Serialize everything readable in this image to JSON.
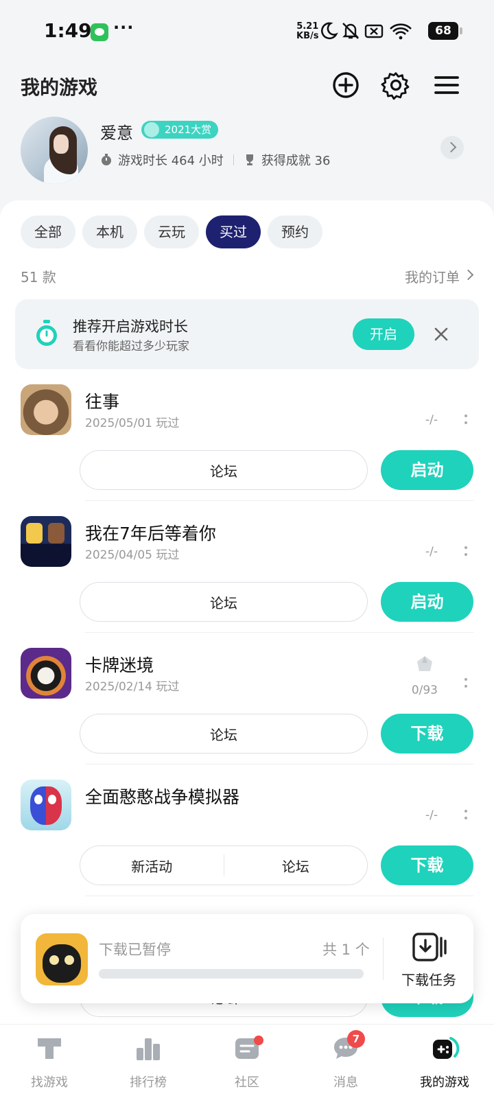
{
  "status_bar": {
    "time": "1:49",
    "more": "···",
    "speed_value": "5.21",
    "speed_unit": "KB/s",
    "battery": "68"
  },
  "header": {
    "title": "我的游戏"
  },
  "profile": {
    "username": "爱意",
    "badge": "2021大赏",
    "playtime": "游戏时长 464 小时",
    "achievements": "获得成就 36"
  },
  "filters": [
    {
      "label": "全部",
      "active": false
    },
    {
      "label": "本机",
      "active": false
    },
    {
      "label": "云玩",
      "active": false
    },
    {
      "label": "买过",
      "active": true
    },
    {
      "label": "预约",
      "active": false
    }
  ],
  "list_meta": {
    "count": "51 款",
    "orders": "我的订单"
  },
  "tip": {
    "title": "推荐开启游戏时长",
    "subtitle": "看看你能超过多少玩家",
    "button": "开启"
  },
  "games": [
    {
      "name": "往事",
      "date": "2025/05/01 玩过",
      "achievement": "-/-",
      "forum": "论坛",
      "action": "启动"
    },
    {
      "name": "我在7年后等着你",
      "date": "2025/04/05 玩过",
      "achievement": "-/-",
      "forum": "论坛",
      "action": "启动"
    },
    {
      "name": "卡牌迷境",
      "date": "2025/02/14 玩过",
      "achievement": "0/93",
      "forum": "论坛",
      "action": "下载"
    },
    {
      "name": "全面憨憨战争模拟器",
      "date": "",
      "achievement": "-/-",
      "event": "新活动",
      "forum": "论坛",
      "action": "下载"
    },
    {
      "forum": "论坛",
      "action": "下载"
    }
  ],
  "download": {
    "status": "下载已暂停",
    "count": "共 1 个",
    "progress": 0,
    "task_label": "下载任务"
  },
  "nav": [
    {
      "label": "找游戏",
      "icon": "find-game-icon"
    },
    {
      "label": "排行榜",
      "icon": "ranking-icon"
    },
    {
      "label": "社区",
      "icon": "community-icon"
    },
    {
      "label": "消息",
      "icon": "message-icon",
      "badge": "7"
    },
    {
      "label": "我的游戏",
      "icon": "my-games-icon"
    }
  ],
  "colors": {
    "accent": "#1fd2bb",
    "active_chip": "#1e2170",
    "badge_red": "#f04a4a"
  }
}
